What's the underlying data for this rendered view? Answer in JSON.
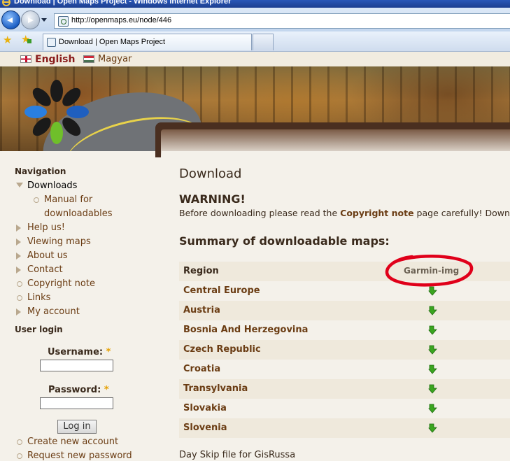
{
  "browser": {
    "window_title": "Download | Open Maps Project - Windows Internet Explorer",
    "address": "http://openmaps.eu/node/446",
    "tab_title": "Download | Open Maps Project"
  },
  "languages": [
    {
      "label": "English",
      "active": true
    },
    {
      "label": "Magyar",
      "active": false
    }
  ],
  "sidebar": {
    "nav_heading": "Navigation",
    "items": [
      {
        "label": "Downloads",
        "state": "open"
      },
      {
        "label": "Manual for",
        "state": "leaf"
      },
      {
        "label": "downloadables",
        "state": "leaf-cont"
      },
      {
        "label": "Help us!",
        "state": "closed"
      },
      {
        "label": "Viewing maps",
        "state": "closed"
      },
      {
        "label": "About us",
        "state": "closed"
      },
      {
        "label": "Contact",
        "state": "closed"
      },
      {
        "label": "Copyright note",
        "state": "leaf"
      },
      {
        "label": "Links",
        "state": "leaf"
      },
      {
        "label": "My account",
        "state": "closed"
      }
    ],
    "login_heading": "User login",
    "username_label": "Username:",
    "password_label": "Password:",
    "required_mark": "*",
    "login_button": "Log in",
    "create_account": "Create new account",
    "request_password": "Request new password"
  },
  "main": {
    "title": "Download",
    "warning": "WARNING!",
    "note_before": "Before downloading please read the ",
    "note_link": "Copyright note",
    "note_after": " page carefully! Downlo",
    "summary_heading": "Summary of downloadable maps:",
    "table": {
      "headers": [
        "Region",
        "Garmin-img"
      ],
      "rows": [
        "Central Europe",
        "Austria",
        "Bosnia And Herzegovina",
        "Czech Republic",
        "Croatia",
        "Transylvania",
        "Slovakia",
        "Slovenia"
      ]
    },
    "footer_text": "Day Skip file for GisRussa"
  },
  "colors": {
    "link_brown": "#6b3d14",
    "highlight_circle": "#e0001a",
    "download_icon": "#3aa51f"
  }
}
